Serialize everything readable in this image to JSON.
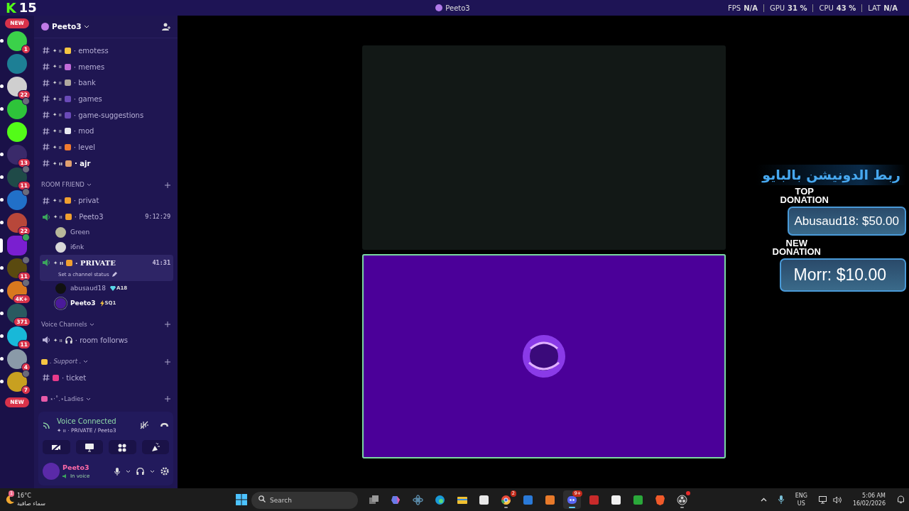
{
  "title_bar": {
    "logo": "K",
    "logo_number": "15",
    "title": "Peeto3",
    "stats": [
      {
        "label": "FPS",
        "value": "N/A"
      },
      {
        "label": "GPU",
        "value": "31 %"
      },
      {
        "label": "CPU",
        "value": "43 %"
      },
      {
        "label": "LAT",
        "value": "N/A"
      }
    ]
  },
  "server_rail": {
    "top_pill": "NEW",
    "bottom_pill": "NEW",
    "servers": [
      {
        "color": "#3bd14a",
        "badge": "1",
        "unread": true,
        "selected": false,
        "kind": "plain"
      },
      {
        "color": "#1d7f95",
        "unread": false,
        "selected": false,
        "kind": "plain"
      },
      {
        "color": "#cfcfcf",
        "badge": "22",
        "unread": true,
        "selected": false,
        "kind": "plain"
      },
      {
        "color": "#2ec43a",
        "unread": true,
        "selected": false,
        "kind": "screen"
      },
      {
        "color": "#53fc18",
        "unread": false,
        "selected": false,
        "kind": "plain"
      },
      {
        "color": "#3a2a6a",
        "badge": "13",
        "unread": true,
        "selected": false,
        "kind": "plain"
      },
      {
        "color": "#1f4a48",
        "badge": "11",
        "unread": true,
        "selected": false,
        "kind": "screen"
      },
      {
        "color": "#2170c8",
        "unread": true,
        "selected": false,
        "kind": "speaker"
      },
      {
        "color": "#b8473a",
        "badge": "22",
        "unread": true,
        "selected": false,
        "kind": "plain"
      },
      {
        "color": "#7a1fd0",
        "unread": false,
        "selected": true,
        "kind": "speaker_active"
      },
      {
        "color": "#5a4a10",
        "badge": "11",
        "unread": true,
        "selected": false,
        "kind": "speaker"
      },
      {
        "color": "#d8781e",
        "badge": "4K+",
        "unread": true,
        "selected": false,
        "kind": "speaker"
      },
      {
        "color": "#2a5a60",
        "badge": "371",
        "unread": true,
        "selected": false,
        "kind": "plain"
      },
      {
        "color": "#18b8d8",
        "badge": "11",
        "unread": true,
        "selected": false,
        "kind": "plain"
      },
      {
        "color": "#8a9aa8",
        "badge": "4",
        "unread": true,
        "selected": false,
        "kind": "plain"
      },
      {
        "color": "#c8a020",
        "badge": "7",
        "unread": true,
        "selected": false,
        "kind": "screen"
      }
    ]
  },
  "server_header": {
    "name": "Peeto3"
  },
  "sections": [
    {
      "channels": [
        {
          "kind": "text",
          "prefix": "✦ ıı",
          "color": "#f5c542",
          "name": "· emotess",
          "unread": false,
          "selected": false
        },
        {
          "kind": "text",
          "prefix": "✦ ıı",
          "color": "#c06ad8",
          "name": "· memes",
          "unread": false,
          "selected": false
        },
        {
          "kind": "text",
          "prefix": "✦ ıı",
          "color": "#b0a8a0",
          "name": "· bank",
          "unread": false,
          "selected": false
        },
        {
          "kind": "text",
          "prefix": "✦ ıı",
          "color": "#6a4ab8",
          "name": "· games",
          "unread": false,
          "selected": false
        },
        {
          "kind": "text",
          "prefix": "✦ ıı",
          "color": "#6a4ab8",
          "name": "· game-suggestions",
          "unread": false,
          "selected": false
        },
        {
          "kind": "text",
          "prefix": "✦ ıı",
          "color": "#e8e8f0",
          "name": "· mod",
          "unread": false,
          "selected": false
        },
        {
          "kind": "text",
          "prefix": "✦ ıı",
          "color": "#f07a30",
          "name": "· level",
          "unread": false,
          "selected": false
        },
        {
          "kind": "text",
          "prefix": "✦ ıı",
          "color": "#e0a070",
          "name": "· ajr",
          "unread": true,
          "selected": false
        }
      ]
    },
    {
      "title": "ROOM FRIEND",
      "italic": false,
      "channels": [
        {
          "kind": "text",
          "prefix": "✦ ıı",
          "color": "#f0a030",
          "name": "· privat",
          "unread": false,
          "selected": false
        },
        {
          "kind": "voice",
          "prefix": "✦ ıı",
          "color": "#f0a030",
          "name": "· Peeto3",
          "unread": false,
          "selected": false,
          "active": true,
          "time": "9:12:29",
          "members": [
            {
              "name": "Green",
              "color": "#b8b89a"
            },
            {
              "name": "i6nk",
              "color": "#d8d8d8"
            }
          ]
        },
        {
          "kind": "voice",
          "prefix": "✦ ıı",
          "color": "#f0a030",
          "name": "· PRIVATE",
          "unread": true,
          "selected": true,
          "active": true,
          "time": "41:31",
          "status": "Set a channel status",
          "members": [
            {
              "name": "abusaud18",
              "color": "#111111",
              "tag": {
                "kind": "gem",
                "text": "A18"
              }
            },
            {
              "name": "Peeto3",
              "color": "#4a1a9a",
              "tag": {
                "kind": "bolt",
                "text": "SQ1"
              },
              "speaking": true
            }
          ]
        }
      ]
    },
    {
      "title": "Voice Channels",
      "italic": false,
      "channels": [
        {
          "kind": "voice",
          "prefix": "✦ ıı",
          "name": "· room follorws",
          "unread": false,
          "selected": false,
          "active": false
        }
      ]
    },
    {
      "title": ". Support .",
      "italic": true,
      "color": "#f5c542",
      "channels": [
        {
          "kind": "text",
          "color": "#e83a8a",
          "name": "· ticket",
          "unread": false,
          "selected": false
        }
      ]
    },
    {
      "title": "⋆·˚.⋆Ladies",
      "italic": false,
      "color": "#e85aa8"
    }
  ],
  "voice_panel": {
    "title": "Voice Connected",
    "channel": "✦ ıı · PRIVATE / Peeto3"
  },
  "user_panel": {
    "name": "Peeto3",
    "status": "In voice"
  },
  "tiles": [
    {
      "kind": "blank",
      "speaking": false
    },
    {
      "kind": "avatar",
      "speaking": true
    }
  ],
  "overlay": {
    "banner": "ربط الدونيشن بالبايو",
    "donations": [
      {
        "line1": "TOP",
        "line2": "DONATION",
        "amount": "Abusaud18: $50.00"
      },
      {
        "line1": "NEW",
        "line2": "DONATION",
        "amount": "Morr: $10.00"
      }
    ]
  },
  "taskbar": {
    "weather": {
      "badge": "1",
      "temp": "16°C",
      "text": "سماء صافية"
    },
    "search": {
      "placeholder": "Search"
    },
    "apps": [
      {
        "kind": "taskview",
        "color": "#9a9a9a",
        "running": false
      },
      {
        "kind": "copilot",
        "color": "#6a7ae8",
        "running": false
      },
      {
        "kind": "atom",
        "color": "#5a8aa8",
        "running": false
      },
      {
        "kind": "edge",
        "color": "#1a9ad8",
        "running": false
      },
      {
        "kind": "folder",
        "color": "#f0c030",
        "running": false
      },
      {
        "kind": "store",
        "color": "#e8e8e8",
        "running": false
      },
      {
        "kind": "chrome",
        "color": "#e84a3a",
        "running": true,
        "badge": "2"
      },
      {
        "kind": "mail",
        "color": "#2a7ad8",
        "running": false
      },
      {
        "kind": "app",
        "color": "#e87a2a",
        "running": false
      },
      {
        "kind": "discord",
        "color": "#5865f2",
        "running": true,
        "selected": true,
        "badge": "9+"
      },
      {
        "kind": "app",
        "color": "#c82a2a",
        "running": false
      },
      {
        "kind": "app",
        "color": "#f0f0f0",
        "running": false
      },
      {
        "kind": "app",
        "color": "#2aa83a",
        "running": false
      },
      {
        "kind": "brave",
        "color": "#f05a2a",
        "running": false
      },
      {
        "kind": "obs",
        "color": "#3a3a3a",
        "running": true,
        "dot": true
      }
    ],
    "lang": "ENG",
    "region": "US",
    "time": "5:06 AM",
    "date": "16/02/2026"
  }
}
